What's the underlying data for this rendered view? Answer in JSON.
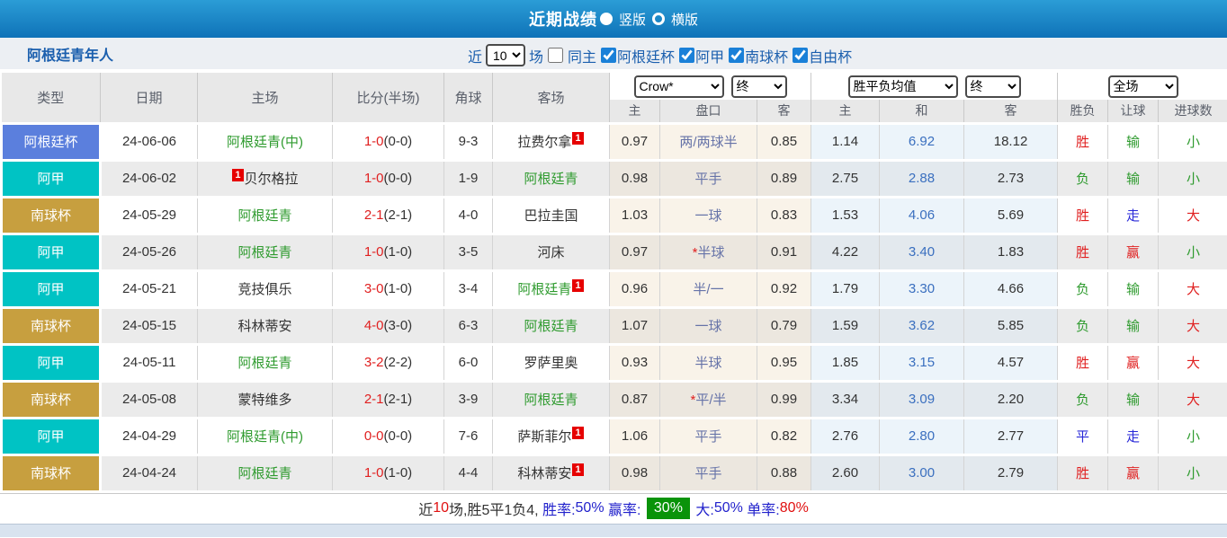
{
  "titlebar": {
    "title": "近期战绩",
    "vertical_label": "竖版",
    "horizontal_label": "横版"
  },
  "filterbar": {
    "team_name": "阿根廷青年人",
    "recent_label": "近",
    "recent_value": "10",
    "games_label": "场",
    "same_home_away_label": "同主",
    "leagues": [
      "阿根廷杯",
      "阿甲",
      "南球杯",
      "自由杯"
    ]
  },
  "table": {
    "dropdowns": {
      "company": "Crow*",
      "company_time": "终",
      "avg": "胜平负均值",
      "avg_time": "终",
      "period": "全场"
    },
    "headers": {
      "type": "类型",
      "date": "日期",
      "home": "主场",
      "score": "比分(半场)",
      "corner": "角球",
      "away": "客场",
      "odds_home": "主",
      "handicap": "盘口",
      "odds_away": "客",
      "avg_home": "主",
      "avg_draw": "和",
      "avg_away": "客",
      "result": "胜负",
      "handicap_result": "让球",
      "goals": "进球数"
    },
    "rows": [
      {
        "league": "阿根廷杯",
        "date": "24-06-06",
        "home": "阿根廷青(中)",
        "home_green": true,
        "home_card": null,
        "score": "1-0",
        "half": "(0-0)",
        "corner": "9-3",
        "away": "拉费尔拿",
        "away_green": false,
        "away_card": "1",
        "odds_home": "0.97",
        "handicap_star": false,
        "handicap": "两/两球半",
        "odds_away": "0.85",
        "avg_home": "1.14",
        "avg_draw": "6.92",
        "avg_away": "18.12",
        "result": "胜",
        "result_c": "red",
        "let_result": "输",
        "let_c": "green",
        "goals": "小",
        "goals_c": "green"
      },
      {
        "league": "阿甲",
        "date": "24-06-02",
        "home": "贝尔格拉",
        "home_green": false,
        "home_card": "1",
        "score": "1-0",
        "half": "(0-0)",
        "corner": "1-9",
        "away": "阿根廷青",
        "away_green": true,
        "away_card": null,
        "odds_home": "0.98",
        "handicap_star": false,
        "handicap": "平手",
        "odds_away": "0.89",
        "avg_home": "2.75",
        "avg_draw": "2.88",
        "avg_away": "2.73",
        "result": "负",
        "result_c": "green",
        "let_result": "输",
        "let_c": "green",
        "goals": "小",
        "goals_c": "green"
      },
      {
        "league": "南球杯",
        "date": "24-05-29",
        "home": "阿根廷青",
        "home_green": true,
        "home_card": null,
        "score": "2-1",
        "half": "(2-1)",
        "corner": "4-0",
        "away": "巴拉圭国",
        "away_green": false,
        "away_card": null,
        "odds_home": "1.03",
        "handicap_star": false,
        "handicap": "一球",
        "odds_away": "0.83",
        "avg_home": "1.53",
        "avg_draw": "4.06",
        "avg_away": "5.69",
        "result": "胜",
        "result_c": "red",
        "let_result": "走",
        "let_c": "blue",
        "goals": "大",
        "goals_c": "red"
      },
      {
        "league": "阿甲",
        "date": "24-05-26",
        "home": "阿根廷青",
        "home_green": true,
        "home_card": null,
        "score": "1-0",
        "half": "(1-0)",
        "corner": "3-5",
        "away": "河床",
        "away_green": false,
        "away_card": null,
        "odds_home": "0.97",
        "handicap_star": true,
        "handicap": "半球",
        "odds_away": "0.91",
        "avg_home": "4.22",
        "avg_draw": "3.40",
        "avg_away": "1.83",
        "result": "胜",
        "result_c": "red",
        "let_result": "赢",
        "let_c": "red",
        "goals": "小",
        "goals_c": "green"
      },
      {
        "league": "阿甲",
        "date": "24-05-21",
        "home": "竞技俱乐",
        "home_green": false,
        "home_card": null,
        "score": "3-0",
        "half": "(1-0)",
        "corner": "3-4",
        "away": "阿根廷青",
        "away_green": true,
        "away_card": "1",
        "odds_home": "0.96",
        "handicap_star": false,
        "handicap": "半/一",
        "odds_away": "0.92",
        "avg_home": "1.79",
        "avg_draw": "3.30",
        "avg_away": "4.66",
        "result": "负",
        "result_c": "green",
        "let_result": "输",
        "let_c": "green",
        "goals": "大",
        "goals_c": "red"
      },
      {
        "league": "南球杯",
        "date": "24-05-15",
        "home": "科林蒂安",
        "home_green": false,
        "home_card": null,
        "score": "4-0",
        "half": "(3-0)",
        "corner": "6-3",
        "away": "阿根廷青",
        "away_green": true,
        "away_card": null,
        "odds_home": "1.07",
        "handicap_star": false,
        "handicap": "一球",
        "odds_away": "0.79",
        "avg_home": "1.59",
        "avg_draw": "3.62",
        "avg_away": "5.85",
        "result": "负",
        "result_c": "green",
        "let_result": "输",
        "let_c": "green",
        "goals": "大",
        "goals_c": "red"
      },
      {
        "league": "阿甲",
        "date": "24-05-11",
        "home": "阿根廷青",
        "home_green": true,
        "home_card": null,
        "score": "3-2",
        "half": "(2-2)",
        "corner": "6-0",
        "away": "罗萨里奥",
        "away_green": false,
        "away_card": null,
        "odds_home": "0.93",
        "handicap_star": false,
        "handicap": "半球",
        "odds_away": "0.95",
        "avg_home": "1.85",
        "avg_draw": "3.15",
        "avg_away": "4.57",
        "result": "胜",
        "result_c": "red",
        "let_result": "赢",
        "let_c": "red",
        "goals": "大",
        "goals_c": "red"
      },
      {
        "league": "南球杯",
        "date": "24-05-08",
        "home": "蒙特维多",
        "home_green": false,
        "home_card": null,
        "score": "2-1",
        "half": "(2-1)",
        "corner": "3-9",
        "away": "阿根廷青",
        "away_green": true,
        "away_card": null,
        "odds_home": "0.87",
        "handicap_star": true,
        "handicap": "平/半",
        "odds_away": "0.99",
        "avg_home": "3.34",
        "avg_draw": "3.09",
        "avg_away": "2.20",
        "result": "负",
        "result_c": "green",
        "let_result": "输",
        "let_c": "green",
        "goals": "大",
        "goals_c": "red"
      },
      {
        "league": "阿甲",
        "date": "24-04-29",
        "home": "阿根廷青(中)",
        "home_green": true,
        "home_card": null,
        "score": "0-0",
        "half": "(0-0)",
        "corner": "7-6",
        "away": "萨斯菲尔",
        "away_green": false,
        "away_card": "1",
        "odds_home": "1.06",
        "handicap_star": false,
        "handicap": "平手",
        "odds_away": "0.82",
        "avg_home": "2.76",
        "avg_draw": "2.80",
        "avg_away": "2.77",
        "result": "平",
        "result_c": "blue",
        "let_result": "走",
        "let_c": "blue",
        "goals": "小",
        "goals_c": "green"
      },
      {
        "league": "南球杯",
        "date": "24-04-24",
        "home": "阿根廷青",
        "home_green": true,
        "home_card": null,
        "score": "1-0",
        "half": "(1-0)",
        "corner": "4-4",
        "away": "科林蒂安",
        "away_green": false,
        "away_card": "1",
        "odds_home": "0.98",
        "handicap_star": false,
        "handicap": "平手",
        "odds_away": "0.88",
        "avg_home": "2.60",
        "avg_draw": "3.00",
        "avg_away": "2.79",
        "result": "胜",
        "result_c": "red",
        "let_result": "赢",
        "let_c": "red",
        "goals": "小",
        "goals_c": "green"
      }
    ]
  },
  "footer": {
    "segments": [
      {
        "t": "近",
        "c": "dark"
      },
      {
        "t": "10",
        "c": "red"
      },
      {
        "t": "场,胜5平1负4, ",
        "c": "dark"
      },
      {
        "t": "胜率:",
        "c": "blue"
      },
      {
        "t": "50%",
        "c": "blue"
      },
      {
        "t": " 赢率: ",
        "c": "blue"
      },
      {
        "t": "30%",
        "c": "badge"
      },
      {
        "t": " 大:",
        "c": "blue"
      },
      {
        "t": "50%",
        "c": "blue"
      },
      {
        "t": " 单率:",
        "c": "blue"
      },
      {
        "t": "80%",
        "c": "red"
      }
    ]
  },
  "colors": {
    "league": {
      "阿根廷杯": "#5b7fdd",
      "阿甲": "#00c3c4",
      "南球杯": "#c79f3f"
    },
    "titlebar_blue": "#1487c8",
    "card_red": "#e60000",
    "badge_green": "#0a930a",
    "team_green": "#2f9b2f",
    "score_red": "#e02020"
  }
}
